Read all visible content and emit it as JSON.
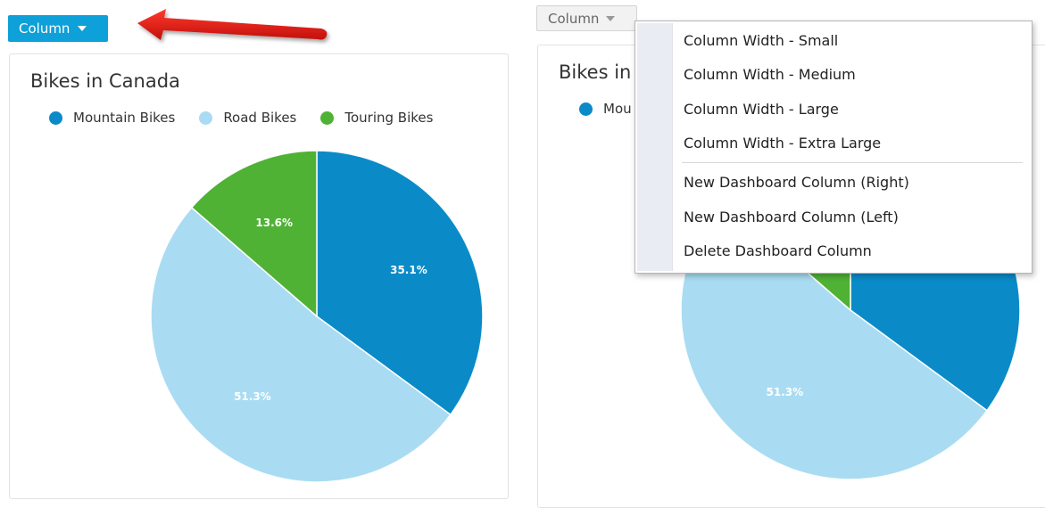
{
  "left_panel": {
    "column_button": "Column",
    "card_title": "Bikes in Canada",
    "legend": [
      {
        "label": "Mountain Bikes",
        "color": "#0a8bc8"
      },
      {
        "label": "Road Bikes",
        "color": "#a9dcf2"
      },
      {
        "label": "Touring Bikes",
        "color": "#4fb235"
      }
    ]
  },
  "right_panel": {
    "column_button": "Column",
    "card_title_partial": "Bikes in",
    "legend_partial": "Mou"
  },
  "dropdown_menu": {
    "items": [
      "Column Width - Small",
      "Column Width - Medium",
      "Column Width - Large",
      "Column Width - Extra Large",
      "New Dashboard Column (Right)",
      "New Dashboard Column (Left)",
      "Delete Dashboard Column"
    ]
  },
  "chart_data": [
    {
      "type": "pie",
      "title": "Bikes in Canada",
      "categories": [
        "Mountain Bikes",
        "Road Bikes",
        "Touring Bikes"
      ],
      "values": [
        35.1,
        51.3,
        13.6
      ],
      "labels": [
        "35.1%",
        "51.3%",
        "13.6%"
      ],
      "colors": [
        "#0a8bc8",
        "#a9dcf2",
        "#4fb235"
      ],
      "legend_position": "top"
    },
    {
      "type": "pie",
      "title": "Bikes in",
      "categories": [
        "Mountain Bikes",
        "Road Bikes",
        "Touring Bikes"
      ],
      "values": [
        35.1,
        51.3,
        13.6
      ],
      "labels": [
        "51.3%"
      ],
      "colors": [
        "#0a8bc8",
        "#a9dcf2",
        "#4fb235"
      ],
      "legend_position": "top"
    }
  ]
}
